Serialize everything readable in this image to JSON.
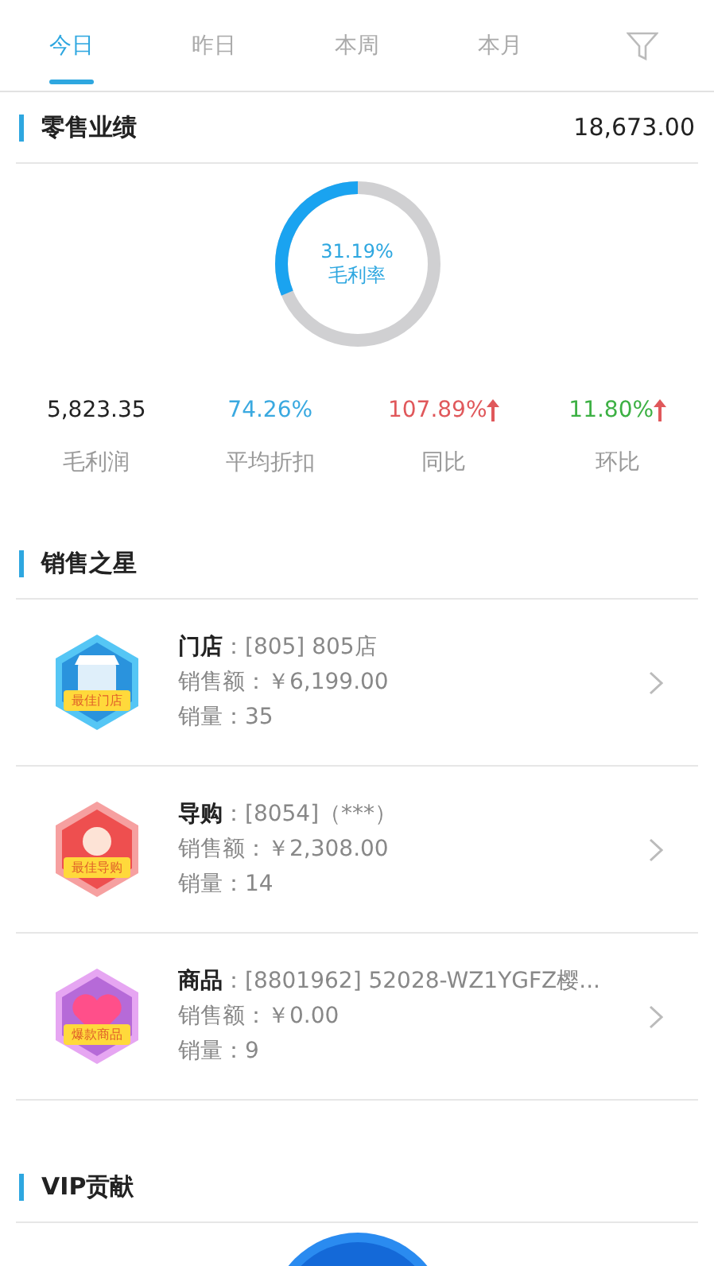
{
  "tabs": [
    {
      "label": "今日",
      "selected": true
    },
    {
      "label": "昨日",
      "selected": false
    },
    {
      "label": "本周",
      "selected": false
    },
    {
      "label": "本月",
      "selected": false
    }
  ],
  "retail": {
    "title": "零售业绩",
    "total": "18,673.00",
    "gauge": {
      "value": "31.19%",
      "label": "毛利率"
    },
    "stats": [
      {
        "value": "5,823.35",
        "label": "毛利润",
        "color": "#222222",
        "kind": "plain"
      },
      {
        "value": "74.26%",
        "label": "平均折扣",
        "color": "#3aa9e0",
        "kind": "plain"
      },
      {
        "value": "107.89%",
        "label": "同比",
        "color": "#e0585b",
        "kind": "rising"
      },
      {
        "value": "11.80%",
        "label": "环比",
        "color": "#3cb043",
        "kind": "rising"
      }
    ]
  },
  "stars": {
    "title": "销售之星",
    "items": [
      {
        "kind": "store",
        "badge": "最佳门店",
        "label": "门店",
        "value": "：[805] 805店",
        "amount": "销售额：￥6,199.00",
        "quantity": "销量：35"
      },
      {
        "kind": "guide",
        "badge": "最佳导购",
        "label": "导购",
        "value": "：[8054]（***）",
        "amount": "销售额：￥2,308.00",
        "quantity": "销量：14"
      },
      {
        "kind": "product",
        "badge": "爆款商品",
        "label": "商品",
        "value": "：[8801962] 52028-WZ1YGFZ樱...",
        "amount": "销售额：￥0.00",
        "quantity": "销量：9"
      }
    ]
  },
  "vip": {
    "title": "VIP贡献"
  }
}
